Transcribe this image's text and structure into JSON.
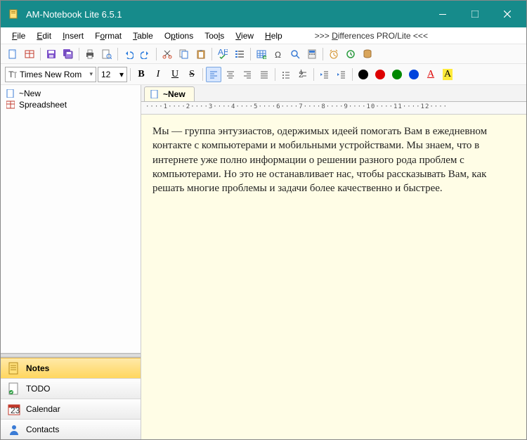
{
  "window": {
    "title": "AM-Notebook Lite  6.5.1"
  },
  "menu": {
    "file": "File",
    "edit": "Edit",
    "insert": "Insert",
    "format": "Format",
    "table": "Table",
    "options": "Options",
    "tools": "Tools",
    "view": "View",
    "help": "Help",
    "diff": ">>> Differences PRO/Lite <<<"
  },
  "format": {
    "font": "Times New Rom",
    "size": "12"
  },
  "tree": {
    "item0": "~New",
    "item1": "Spreadsheet"
  },
  "nav": {
    "notes": "Notes",
    "todo": "TODO",
    "calendar": "Calendar",
    "contacts": "Contacts",
    "cal_day": "23"
  },
  "tab": {
    "label": "~New"
  },
  "ruler": "····1····2····3····4····5····6····7····8····9····10····11····12····",
  "editor": {
    "text": "Мы — группа энтузиастов, одержимых идеей помогать Вам в ежедневном контакте с компьютерами и мобильными устройствами. Мы знаем, что в интернете уже полно информации о решении разного рода проблем с компьютерами. Но это не останавливает нас, чтобы рассказывать Вам, как решать многие проблемы и задачи более качественно и быстрее."
  },
  "colors": {
    "black": "#000",
    "red": "#d00",
    "green": "#008800",
    "blue": "#0044dd"
  },
  "glyph": {
    "B": "B",
    "I": "I",
    "U": "U",
    "S": "S",
    "A": "A"
  }
}
